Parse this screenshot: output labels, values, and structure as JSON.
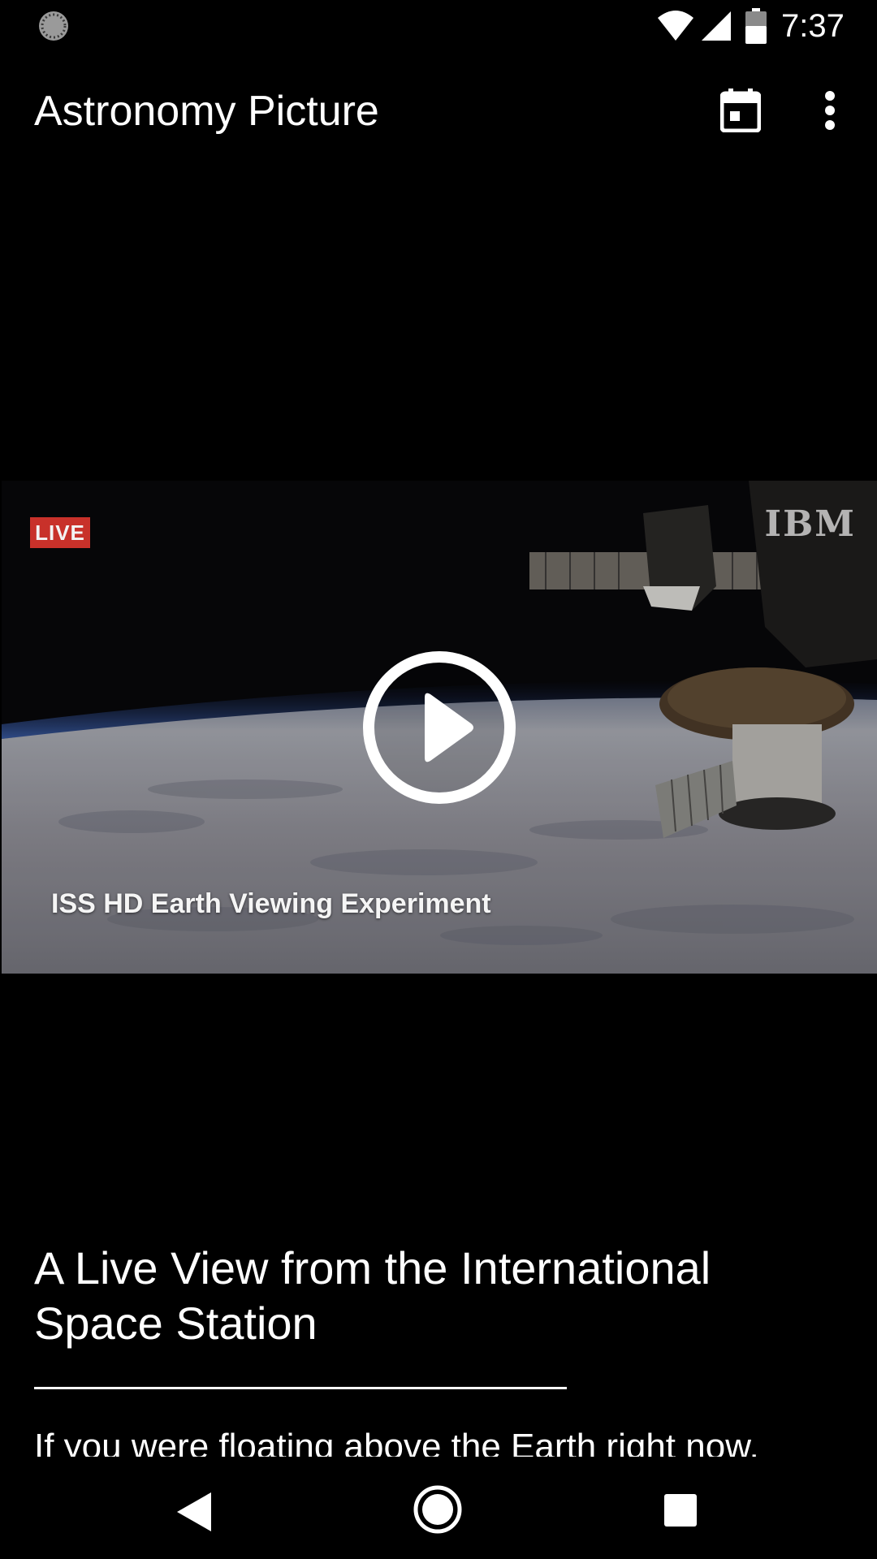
{
  "status_bar": {
    "time": "7:37",
    "icons": [
      "sync-icon",
      "wifi-icon",
      "cell-signal-icon",
      "battery-icon"
    ]
  },
  "app_bar": {
    "title": "Astronomy Picture",
    "actions": [
      "calendar-icon",
      "more-vert-icon"
    ]
  },
  "video": {
    "live_label": "LIVE",
    "logo_text": "IBM",
    "title": "ISS HD Earth Viewing Experiment",
    "live_badge_color": "#c8312a"
  },
  "article": {
    "title": "A Live View from the International Space Station",
    "body": "If you were floating above the Earth right now,"
  },
  "nav_bar": {
    "buttons": [
      "back-icon",
      "home-icon",
      "recents-icon"
    ]
  }
}
